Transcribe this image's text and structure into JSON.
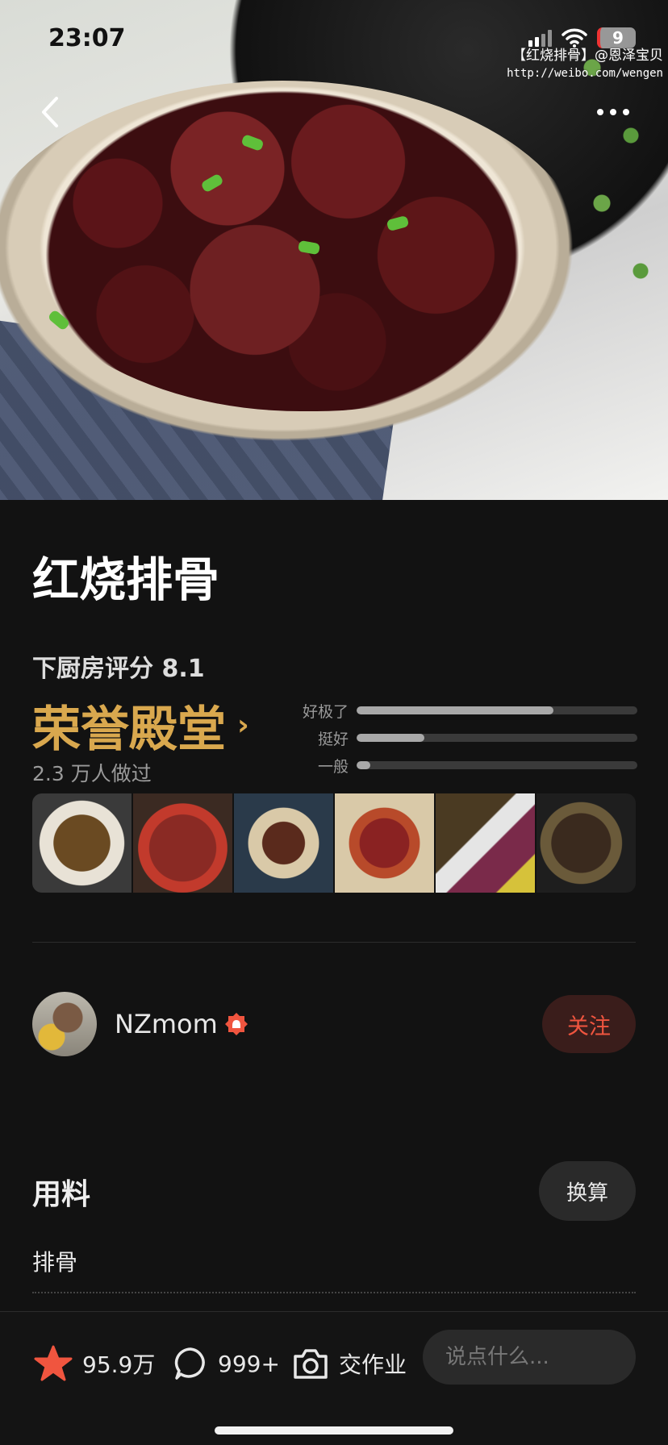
{
  "status_bar": {
    "time": "23:07",
    "battery": "9"
  },
  "hero": {
    "watermark_line1": "【红烧排骨】@恩泽宝贝",
    "watermark_line2": "http://weibo.com/wengen"
  },
  "recipe": {
    "title": "红烧排骨",
    "score_label": "下厨房评分 8.1",
    "honor": "荣誉殿堂",
    "made_count": "2.3 万人做过",
    "ratings": [
      {
        "label": "好极了",
        "fraction": 0.7
      },
      {
        "label": "挺好",
        "fraction": 0.24
      },
      {
        "label": "一般",
        "fraction": 0.05
      }
    ]
  },
  "author": {
    "name": "NZmom",
    "follow_label": "关注"
  },
  "ingredients": {
    "title": "用料",
    "convert_label": "换算",
    "items": [
      {
        "name": "排骨"
      }
    ]
  },
  "bottom_bar": {
    "favorites": "95.9万",
    "comments": "999+",
    "homework": "交作业",
    "comment_placeholder": "说点什么..."
  },
  "colors": {
    "accent": "#f0553f",
    "gold": "#d9a84e",
    "background": "#121212"
  }
}
